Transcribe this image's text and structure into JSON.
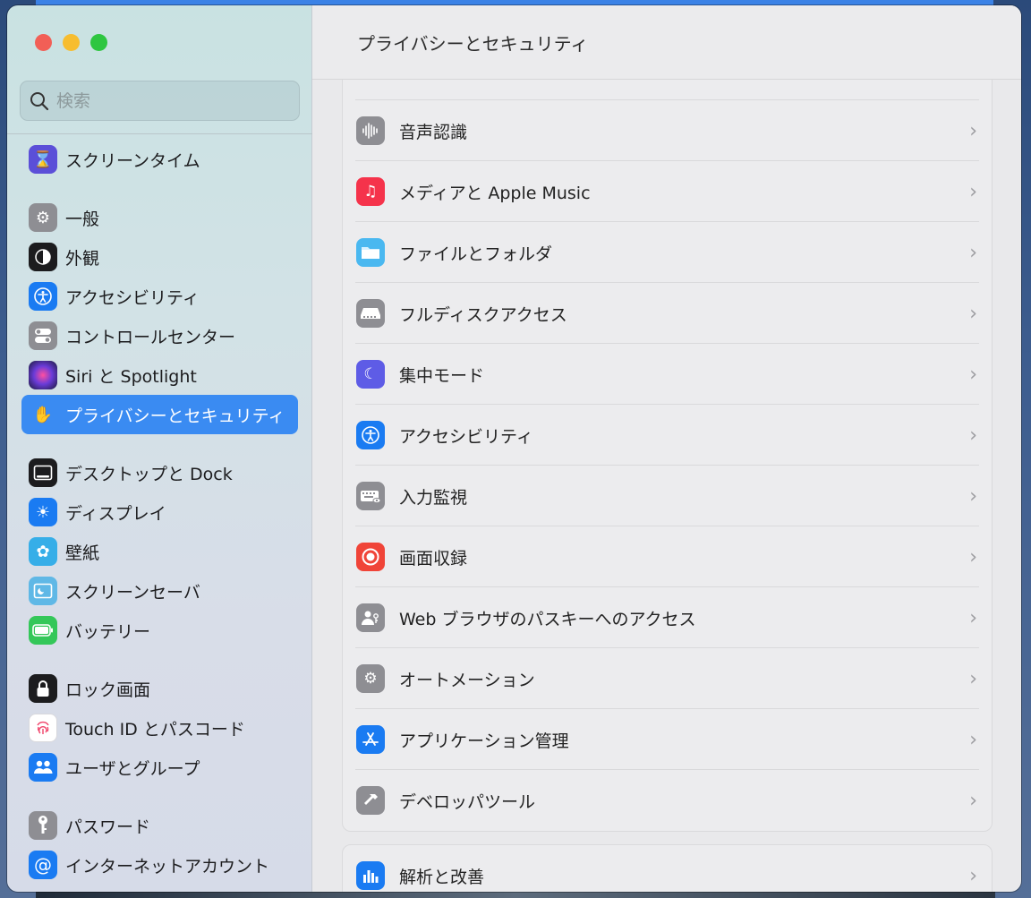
{
  "search": {
    "placeholder": "検索"
  },
  "sidebar": {
    "items": [
      {
        "label": "スクリーンタイム",
        "icon": "hourglass-icon",
        "color": "#5b4fd8"
      },
      {
        "label": "一般",
        "icon": "gear-icon",
        "color": "#8e8e93"
      },
      {
        "label": "外観",
        "icon": "appearance-icon",
        "color": "#1c1c1e"
      },
      {
        "label": "アクセシビリティ",
        "icon": "accessibility-icon",
        "color": "#1a7bf2"
      },
      {
        "label": "コントロールセンター",
        "icon": "toggles-icon",
        "color": "#8e8e93"
      },
      {
        "label": "Siri と Spotlight",
        "icon": "siri-icon",
        "color": "#3a2d6b"
      },
      {
        "label": "プライバシーとセキュリティ",
        "icon": "hand-icon",
        "color": "#3a8bf2"
      },
      {
        "label": "デスクトップと Dock",
        "icon": "dock-icon",
        "color": "#1c1c1e"
      },
      {
        "label": "ディスプレイ",
        "icon": "sun-icon",
        "color": "#1a7bf2"
      },
      {
        "label": "壁紙",
        "icon": "flower-icon",
        "color": "#36aee8"
      },
      {
        "label": "スクリーンセーバ",
        "icon": "screensaver-icon",
        "color": "#5fb8e6"
      },
      {
        "label": "バッテリー",
        "icon": "battery-icon",
        "color": "#34c759"
      },
      {
        "label": "ロック画面",
        "icon": "lock-icon",
        "color": "#1c1c1e"
      },
      {
        "label": "Touch ID とパスコード",
        "icon": "fingerprint-icon",
        "color": "#ffffff"
      },
      {
        "label": "ユーザとグループ",
        "icon": "users-icon",
        "color": "#1a7bf2"
      },
      {
        "label": "パスワード",
        "icon": "key-icon",
        "color": "#8e8e93"
      },
      {
        "label": "インターネットアカウント",
        "icon": "at-icon",
        "color": "#1a7bf2"
      }
    ]
  },
  "main": {
    "title": "プライバシーとセキュリティ",
    "rows": [
      {
        "label": "音声認識",
        "icon": "waveform-icon",
        "color": "#8e8e93"
      },
      {
        "label": "メディアと Apple Music",
        "icon": "music-note-icon",
        "color": "#f5334b"
      },
      {
        "label": "ファイルとフォルダ",
        "icon": "folder-icon",
        "color": "#4ab8f0"
      },
      {
        "label": "フルディスクアクセス",
        "icon": "disk-icon",
        "color": "#8e8e93"
      },
      {
        "label": "集中モード",
        "icon": "moon-icon",
        "color": "#5e5ce6"
      },
      {
        "label": "アクセシビリティ",
        "icon": "accessibility-icon",
        "color": "#1a7bf2"
      },
      {
        "label": "入力監視",
        "icon": "keyboard-eye-icon",
        "color": "#8e8e93"
      },
      {
        "label": "画面収録",
        "icon": "record-icon",
        "color": "#f04438"
      },
      {
        "label": "Web ブラウザのパスキーへのアクセス",
        "icon": "passkey-icon",
        "color": "#8e8e93"
      },
      {
        "label": "オートメーション",
        "icon": "gears-icon",
        "color": "#8e8e93"
      },
      {
        "label": "アプリケーション管理",
        "icon": "app-store-icon",
        "color": "#1a7bf2"
      },
      {
        "label": "デベロッパツール",
        "icon": "hammer-icon",
        "color": "#8e8e93"
      }
    ],
    "extra_rows": [
      {
        "label": "解析と改善",
        "icon": "bar-chart-icon",
        "color": "#1a7bf2"
      }
    ]
  }
}
